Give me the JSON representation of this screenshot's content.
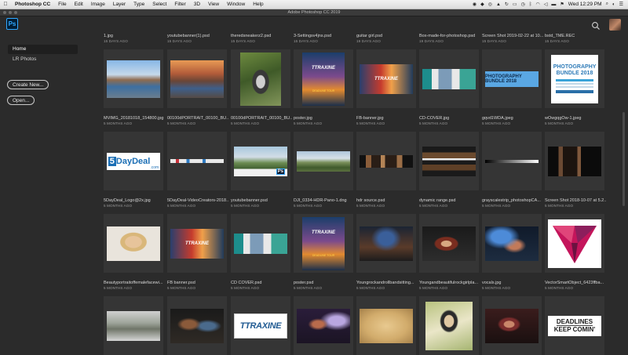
{
  "menubar": {
    "app_name": "Photoshop CC",
    "items": [
      "File",
      "Edit",
      "Image",
      "Layer",
      "Type",
      "Select",
      "Filter",
      "3D",
      "View",
      "Window",
      "Help"
    ],
    "clock": "Wed 12:29 PM",
    "status_icons": [
      "ai-icon",
      "dropbox-icon",
      "cc-icon",
      "gdrive-icon",
      "sync-icon",
      "cast-icon",
      "clock-icon",
      "bluetooth-icon",
      "wifi-icon",
      "volume-icon",
      "battery-icon",
      "flag-icon"
    ]
  },
  "window": {
    "title": "Adobe Photoshop CC 2019"
  },
  "header": {
    "logo_text": "Ps"
  },
  "sidebar": {
    "items": [
      {
        "label": "Home",
        "active": true
      },
      {
        "label": "LR Photos",
        "active": false
      }
    ],
    "create_new": "Create New...",
    "open": "Open..."
  },
  "files": {
    "row1": [
      {
        "name": "1.jpg",
        "date": "15 DAYS AGO"
      },
      {
        "name": "youtubebanner(1).psd",
        "date": "15 DAYS AGO"
      },
      {
        "name": "theredsneakerz2.psd",
        "date": "15 DAYS AGO"
      },
      {
        "name": "3-Settingsv4jns.psd",
        "date": "15 DAYS AGO"
      },
      {
        "name": "guitar girl.psd",
        "date": "19 DAYS AGO"
      },
      {
        "name": "Box-made-for-photoshop.psd",
        "date": "19 DAYS AGO"
      },
      {
        "name": "Screen Shot 2019-02-22 at 10...",
        "date": "15 DAYS AGO"
      },
      {
        "name": "bstd_TME.REC",
        "date": "15 DAYS AGO"
      }
    ],
    "row2": [
      {
        "name": "MVIMG_20181018_154800.jpg",
        "date": "5 MONTHS AGO"
      },
      {
        "name": "00100dPORTRAIT_00100_BU...",
        "date": "5 MONTHS AGO"
      },
      {
        "name": "00100dPORTRAIT_00100_BU...",
        "date": "5 MONTHS AGO"
      },
      {
        "name": "poster.jpg",
        "date": "5 MONTHS AGO"
      },
      {
        "name": "FB-banner.jpg",
        "date": "5 MONTHS AGO"
      },
      {
        "name": "CD-COVER.jpg",
        "date": "5 MONTHS AGO"
      },
      {
        "name": "gqvd1WDA.jpeg",
        "date": "5 MONTHS AGO"
      },
      {
        "name": "wOwgqgOw-1.jpeg",
        "date": "5 MONTHS AGO"
      }
    ],
    "row3": [
      {
        "name": "5DayDeal_Logo@2x.jpg",
        "date": "5 MONTHS AGO"
      },
      {
        "name": "5DayDeal-VideoCreators-2018...",
        "date": "5 MONTHS AGO"
      },
      {
        "name": "youtubebanner.psd",
        "date": "5 MONTHS AGO"
      },
      {
        "name": "DJI_0334-HDR-Pano-1.dng",
        "date": "5 MONTHS AGO"
      },
      {
        "name": "hdr source.psd",
        "date": "5 MONTHS AGO"
      },
      {
        "name": "dynamic range.psd",
        "date": "5 MONTHS AGO"
      },
      {
        "name": "grayscalestrip_photoshopCA...",
        "date": "5 MONTHS AGO"
      },
      {
        "name": "Screen Shot 2018-10-07 at 5.2...",
        "date": "5 MONTHS AGO"
      }
    ],
    "row4": [
      {
        "name": "Beautyportraitoffemalefacewi...",
        "date": "5 MONTHS AGO"
      },
      {
        "name": "FB banner.psd",
        "date": "5 MONTHS AGO"
      },
      {
        "name": "CD COVER.psd",
        "date": "5 MONTHS AGO"
      },
      {
        "name": "poster.psd",
        "date": "5 MONTHS AGO"
      },
      {
        "name": "Youngrockandrollbandsitting...",
        "date": "5 MONTHS AGO"
      },
      {
        "name": "Youngandbeautifulrockgirlpla...",
        "date": "5 MONTHS AGO"
      },
      {
        "name": "vocals.jpg",
        "date": "5 MONTHS AGO"
      },
      {
        "name": "VectorSmartObject_6423ffba...",
        "date": "5 MONTHS AGO"
      }
    ]
  },
  "thumb_text": {
    "photography_bundle": "PHOTOGRAPHY BUNDLE 2018",
    "photography_bundle_small": "PHOTOGRAPHY BUNDLE 2018",
    "daydeal_number": "5",
    "daydeal_word": "DayDeal",
    "daydeal_com": ".com",
    "ttraxine": "TTRAXINE",
    "deadline_tour": "DEADLINE TOUR",
    "deadlines": "DEADLINES",
    "keep_comin": "KEEP COMIN'"
  },
  "colors": {
    "background": "#2b2b2b",
    "tile": "#353535",
    "ps_blue": "#31a8ff",
    "ps_navy": "#001d34",
    "vector_magenta": "#c4155b"
  }
}
